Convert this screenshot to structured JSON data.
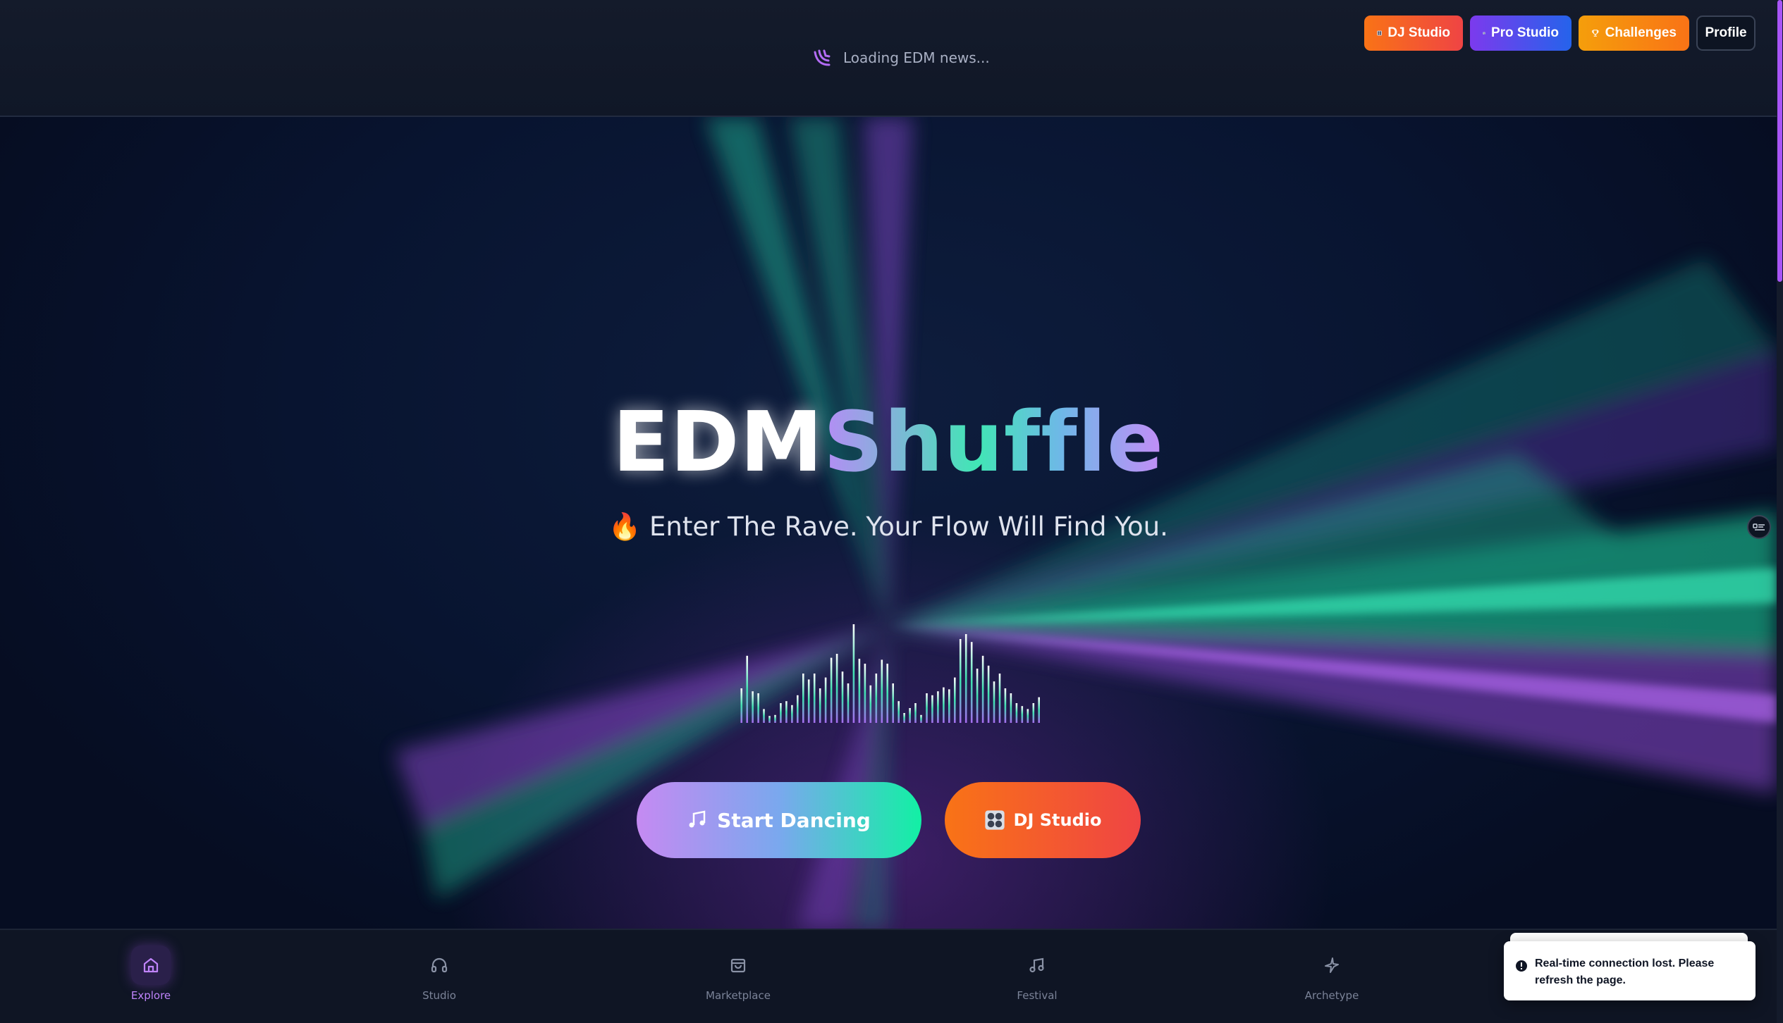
{
  "header": {
    "news_text": "Loading EDM news...",
    "actions": {
      "dj_studio": "DJ Studio",
      "pro_studio": "Pro Studio",
      "challenges": "Challenges",
      "profile": "Profile"
    }
  },
  "hero": {
    "title_part1": "EDM",
    "title_part2": "Shuffle",
    "tagline_emoji": "🔥",
    "tagline": "Enter The Rave. Your Flow Will Find You.",
    "cta_primary": "Start Dancing",
    "cta_secondary": "DJ Studio",
    "equalizer_levels": [
      0.35,
      0.68,
      0.32,
      0.3,
      0.14,
      0.07,
      0.08,
      0.2,
      0.22,
      0.18,
      0.28,
      0.5,
      0.44,
      0.5,
      0.35,
      0.46,
      0.66,
      0.7,
      0.52,
      0.4,
      1.0,
      0.65,
      0.6,
      0.38,
      0.5,
      0.64,
      0.6,
      0.4,
      0.22,
      0.1,
      0.15,
      0.2,
      0.08,
      0.3,
      0.28,
      0.32,
      0.36,
      0.34,
      0.46,
      0.85,
      0.9,
      0.82,
      0.55,
      0.68,
      0.58,
      0.42,
      0.5,
      0.35,
      0.3,
      0.2,
      0.17,
      0.14,
      0.2,
      0.26
    ]
  },
  "bottom_nav": {
    "items": [
      {
        "label": "Explore",
        "icon": "home-icon",
        "active": true
      },
      {
        "label": "Studio",
        "icon": "headphones-icon",
        "active": false
      },
      {
        "label": "Marketplace",
        "icon": "shopping-bag-icon",
        "active": false
      },
      {
        "label": "Festival",
        "icon": "music-note-icon",
        "active": false
      },
      {
        "label": "Archetype",
        "icon": "sparkle-icon",
        "active": false
      }
    ]
  },
  "toast": {
    "message": "Real-time connection lost. Please refresh the page.",
    "icon": "alert-circle-icon"
  },
  "colors": {
    "accent_purple": "#a855f7",
    "accent_green": "#12f0a4",
    "accent_orange": "#f97316",
    "accent_red": "#ef4444",
    "bg_dark": "#0a1226"
  }
}
